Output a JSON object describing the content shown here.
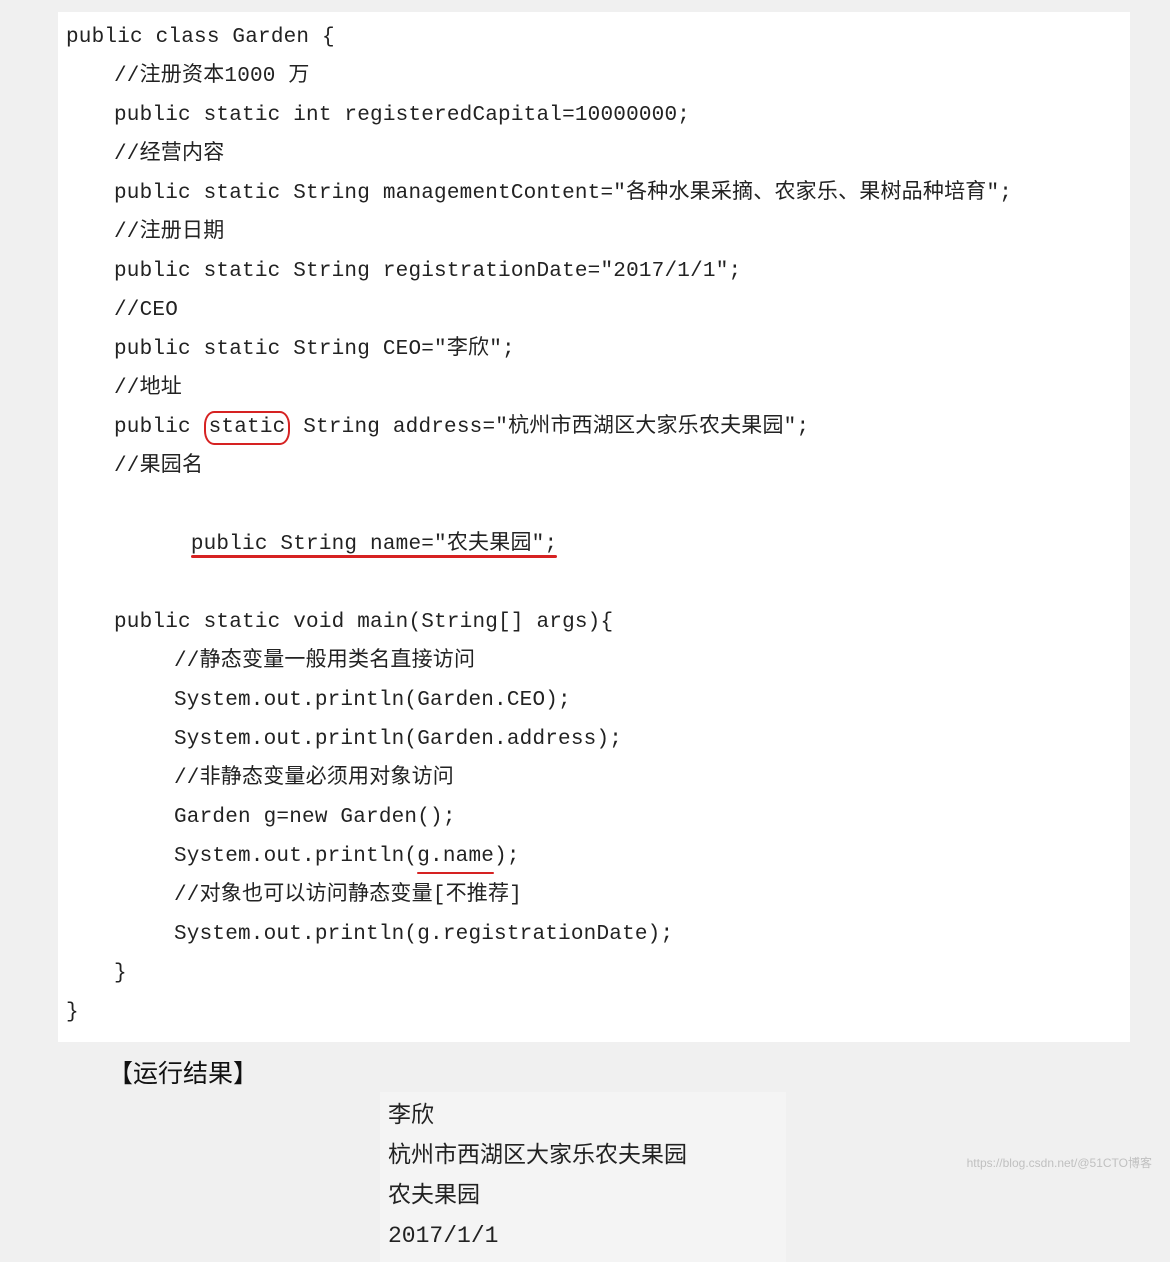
{
  "code": {
    "l01": "public class Garden {",
    "l02": "//注册资本1000 万",
    "l03": "public static int registeredCapital=10000000;",
    "l04": "//经营内容",
    "l05": "public static String managementContent=\"各种水果采摘、农家乐、果树品种培育\";",
    "l06": "//注册日期",
    "l07": "public static String registrationDate=\"2017/1/1\";",
    "l08": "//CEO",
    "l09": "public static String CEO=\"李欣\";",
    "l10": "//地址",
    "l11a": "public ",
    "l11b": "static",
    "l11c": " String address=\"杭州市西湖区大家乐农夫果园\";",
    "l12": "//果园名",
    "l13": "public String name=\"农夫果园\";",
    "l14": "public static void main(String[] args){",
    "l15": "//静态变量一般用类名直接访问",
    "l16": "System.out.println(Garden.CEO);",
    "l17": "System.out.println(Garden.address);",
    "l18": "//非静态变量必须用对象访问",
    "l19": "Garden g=new Garden();",
    "l20a": "System.out.println(",
    "l20b": "g.name",
    "l20c": ");",
    "l21": "//对象也可以访问静态变量[不推荐]",
    "l22": "System.out.println(g.registrationDate);",
    "l23": "}",
    "l24": "}"
  },
  "result_label": "【运行结果】",
  "result": {
    "r1": "李欣",
    "r2": "杭州市西湖区大家乐农夫果园",
    "r3": "农夫果园",
    "r4": "2017/1/1"
  },
  "watermark": "https://blog.csdn.net/@51CTO博客"
}
